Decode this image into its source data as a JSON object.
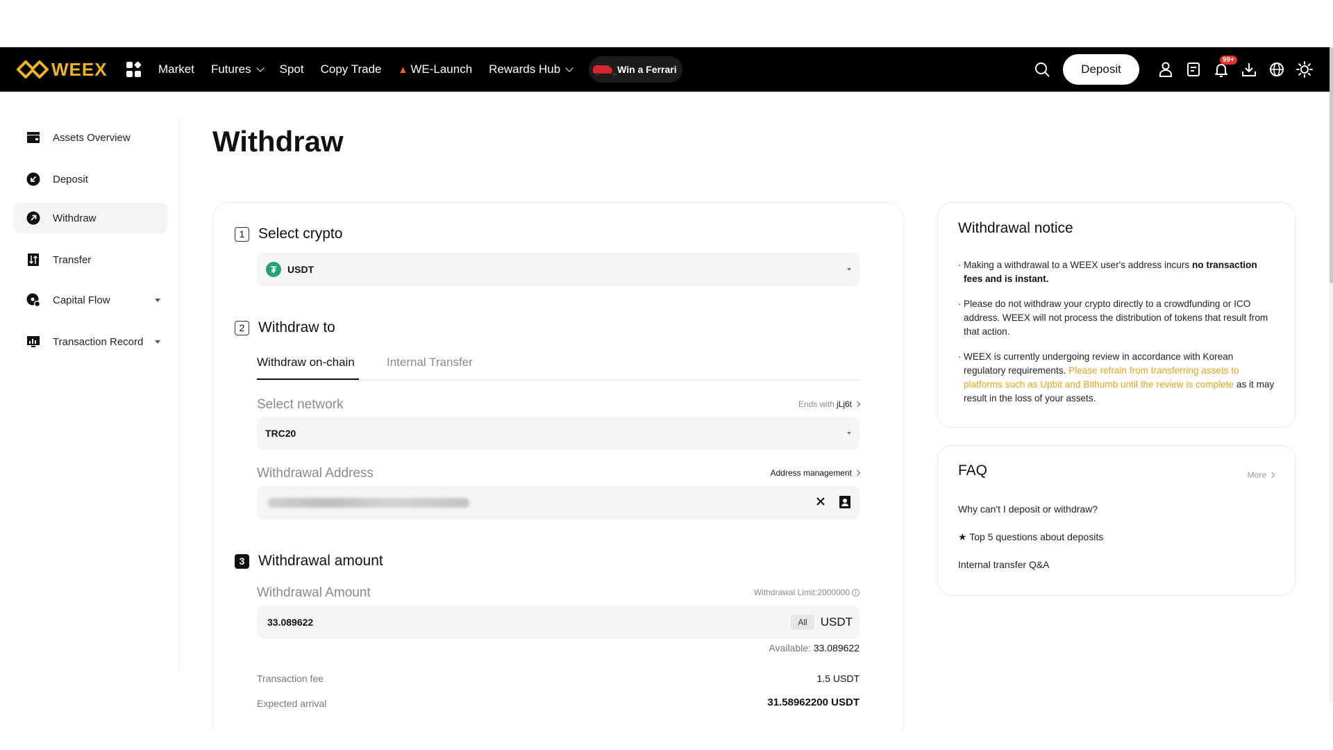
{
  "nav": {
    "brand": "WEEX",
    "items": [
      "Market",
      "Futures",
      "Spot",
      "Copy Trade",
      "WE-Launch",
      "Rewards Hub"
    ],
    "promo": "Win a Ferrari",
    "deposit_label": "Deposit",
    "notification_count": "99+"
  },
  "sidebar": {
    "items": [
      {
        "label": "Assets Overview",
        "icon": "wallet-icon"
      },
      {
        "label": "Deposit",
        "icon": "deposit-arrow-icon"
      },
      {
        "label": "Withdraw",
        "icon": "withdraw-arrow-icon",
        "active": true
      },
      {
        "label": "Transfer",
        "icon": "transfer-icon"
      },
      {
        "label": "Capital Flow",
        "icon": "capital-flow-icon",
        "expandable": true
      },
      {
        "label": "Transaction Record",
        "icon": "record-icon",
        "expandable": true
      }
    ]
  },
  "page": {
    "title": "Withdraw"
  },
  "form": {
    "step1": {
      "number": "1",
      "title": "Select crypto",
      "coin": "USDT"
    },
    "step2": {
      "number": "2",
      "title": "Withdraw to",
      "tabs": [
        "Withdraw on-chain",
        "Internal Transfer"
      ],
      "network_label": "Select network",
      "network_hint_prefix": "Ends with",
      "network_hint_value": "jLj6t",
      "network_value": "TRC20",
      "address_label": "Withdrawal Address",
      "address_management": "Address management"
    },
    "step3": {
      "number": "3",
      "title": "Withdrawal amount",
      "amount_label": "Withdrawal Amount",
      "limit_label": "Withdrawal Limit:2000000",
      "amount_value": "33.089622",
      "all_label": "All",
      "unit": "USDT",
      "available_label": "Available:",
      "available_value": "33.089622",
      "fee_label": "Transaction fee",
      "fee_value": "1.5 USDT",
      "arrival_label": "Expected arrival",
      "arrival_value": "31.58962200 USDT"
    }
  },
  "notice": {
    "title": "Withdrawal notice",
    "item1_text": "Making a withdrawal to a WEEX user's address incurs ",
    "item1_bold": "no transaction fees and is instant.",
    "item2_text": "Please do not withdraw your crypto directly to a crowdfunding or ICO address. WEEX will not process the distribution of tokens that result from that action.",
    "item3_text": "WEEX is currently undergoing review in accordance with Korean regulatory requirements. ",
    "item3_warning": "Please refrain from transferring assets to platforms such as Upbit and Bithumb until the review is complete",
    "item3_tail": " as it may result in the loss of your assets."
  },
  "faq": {
    "title": "FAQ",
    "more_label": "More",
    "items": [
      "Why can't I deposit or withdraw?",
      "★ Top 5 questions about deposits",
      "Internal transfer Q&A"
    ]
  },
  "colors": {
    "brand": "#f0b41b",
    "warning": "#e8a317",
    "nav_bg": "#000000",
    "usdt": "#26a17b",
    "badge": "#e5322d"
  }
}
